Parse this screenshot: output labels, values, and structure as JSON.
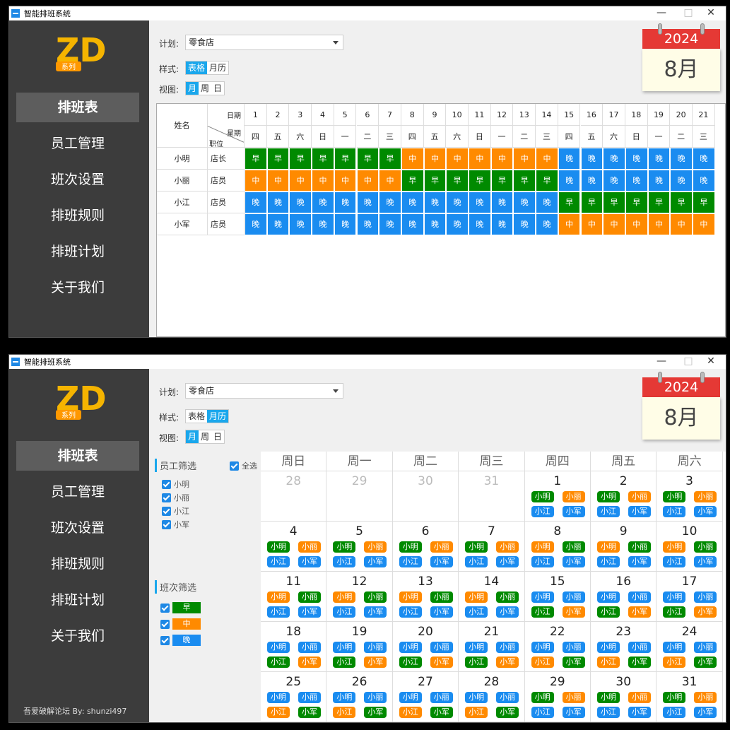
{
  "app_title": "智能排班系统",
  "window_controls": {
    "minimize": "—",
    "maximize": "□",
    "close": "✕"
  },
  "logo": {
    "letters": "ZD",
    "badge": "系列"
  },
  "menu": [
    {
      "label": "排班表",
      "active": true
    },
    {
      "label": "员工管理"
    },
    {
      "label": "班次设置"
    },
    {
      "label": "排班规则"
    },
    {
      "label": "排班计划"
    },
    {
      "label": "关于我们"
    }
  ],
  "credit": "吾爱破解论坛 By: shunzi497",
  "plan": {
    "label": "计划:",
    "value": "零食店"
  },
  "style": {
    "label": "样式:",
    "options": [
      "表格",
      "月历"
    ]
  },
  "view": {
    "label": "视图:",
    "options": [
      "月",
      "周",
      "日"
    ],
    "selected": "月"
  },
  "calendar": {
    "year": "2024",
    "month": "8月"
  },
  "colors": {
    "早": "#008a00",
    "中": "#ff8a00",
    "晚": "#1a8cf0"
  },
  "table": {
    "header_name": "姓名",
    "header_date": "日期",
    "header_week": "星期",
    "header_pos": "职位",
    "dates": [
      "1",
      "2",
      "3",
      "4",
      "5",
      "6",
      "7",
      "8",
      "9",
      "10",
      "11",
      "12",
      "13",
      "14",
      "15",
      "16",
      "17",
      "18",
      "19",
      "20",
      "21"
    ],
    "weekdays": [
      "四",
      "五",
      "六",
      "日",
      "一",
      "二",
      "三",
      "四",
      "五",
      "六",
      "日",
      "一",
      "二",
      "三",
      "四",
      "五",
      "六",
      "日",
      "一",
      "二",
      "三"
    ],
    "rows": [
      {
        "name": "小明",
        "position": "店长",
        "shifts": [
          "早",
          "早",
          "早",
          "早",
          "早",
          "早",
          "早",
          "中",
          "中",
          "中",
          "中",
          "中",
          "中",
          "中",
          "晚",
          "晚",
          "晚",
          "晚",
          "晚",
          "晚",
          "晚"
        ]
      },
      {
        "name": "小丽",
        "position": "店员",
        "shifts": [
          "中",
          "中",
          "中",
          "中",
          "中",
          "中",
          "中",
          "早",
          "早",
          "早",
          "早",
          "早",
          "早",
          "早",
          "晚",
          "晚",
          "晚",
          "晚",
          "晚",
          "晚",
          "晚"
        ]
      },
      {
        "name": "小江",
        "position": "店员",
        "shifts": [
          "晚",
          "晚",
          "晚",
          "晚",
          "晚",
          "晚",
          "晚",
          "晚",
          "晚",
          "晚",
          "晚",
          "晚",
          "晚",
          "晚",
          "早",
          "早",
          "早",
          "早",
          "早",
          "早",
          "早"
        ]
      },
      {
        "name": "小军",
        "position": "店员",
        "shifts": [
          "晚",
          "晚",
          "晚",
          "晚",
          "晚",
          "晚",
          "晚",
          "晚",
          "晚",
          "晚",
          "晚",
          "晚",
          "晚",
          "晚",
          "中",
          "中",
          "中",
          "中",
          "中",
          "中",
          "中"
        ]
      }
    ]
  },
  "filters": {
    "employee_title": "员工筛选",
    "select_all": "全选",
    "employees": [
      "小明",
      "小丽",
      "小江",
      "小军"
    ],
    "shift_title": "班次筛选",
    "shifts": [
      "早",
      "中",
      "晚"
    ]
  },
  "month_view": {
    "weekdays": [
      "周日",
      "周一",
      "周二",
      "周三",
      "周四",
      "周五",
      "周六"
    ],
    "weeks": [
      [
        {
          "d": "28",
          "dim": true
        },
        {
          "d": "29",
          "dim": true
        },
        {
          "d": "30",
          "dim": true
        },
        {
          "d": "31",
          "dim": true
        },
        {
          "d": "1",
          "p": [
            [
              "小明",
              "早"
            ],
            [
              "小丽",
              "中"
            ],
            [
              "小江",
              "晚"
            ],
            [
              "小军",
              "晚"
            ]
          ]
        },
        {
          "d": "2",
          "p": [
            [
              "小明",
              "早"
            ],
            [
              "小丽",
              "中"
            ],
            [
              "小江",
              "晚"
            ],
            [
              "小军",
              "晚"
            ]
          ]
        },
        {
          "d": "3",
          "p": [
            [
              "小明",
              "早"
            ],
            [
              "小丽",
              "中"
            ],
            [
              "小江",
              "晚"
            ],
            [
              "小军",
              "晚"
            ]
          ]
        }
      ],
      [
        {
          "d": "4",
          "p": [
            [
              "小明",
              "早"
            ],
            [
              "小丽",
              "中"
            ],
            [
              "小江",
              "晚"
            ],
            [
              "小军",
              "晚"
            ]
          ]
        },
        {
          "d": "5",
          "p": [
            [
              "小明",
              "早"
            ],
            [
              "小丽",
              "中"
            ],
            [
              "小江",
              "晚"
            ],
            [
              "小军",
              "晚"
            ]
          ]
        },
        {
          "d": "6",
          "p": [
            [
              "小明",
              "早"
            ],
            [
              "小丽",
              "中"
            ],
            [
              "小江",
              "晚"
            ],
            [
              "小军",
              "晚"
            ]
          ]
        },
        {
          "d": "7",
          "p": [
            [
              "小明",
              "早"
            ],
            [
              "小丽",
              "中"
            ],
            [
              "小江",
              "晚"
            ],
            [
              "小军",
              "晚"
            ]
          ]
        },
        {
          "d": "8",
          "p": [
            [
              "小明",
              "中"
            ],
            [
              "小丽",
              "早"
            ],
            [
              "小江",
              "晚"
            ],
            [
              "小军",
              "晚"
            ]
          ]
        },
        {
          "d": "9",
          "p": [
            [
              "小明",
              "中"
            ],
            [
              "小丽",
              "早"
            ],
            [
              "小江",
              "晚"
            ],
            [
              "小军",
              "晚"
            ]
          ]
        },
        {
          "d": "10",
          "p": [
            [
              "小明",
              "中"
            ],
            [
              "小丽",
              "早"
            ],
            [
              "小江",
              "晚"
            ],
            [
              "小军",
              "晚"
            ]
          ]
        }
      ],
      [
        {
          "d": "11",
          "p": [
            [
              "小明",
              "中"
            ],
            [
              "小丽",
              "早"
            ],
            [
              "小江",
              "晚"
            ],
            [
              "小军",
              "晚"
            ]
          ]
        },
        {
          "d": "12",
          "p": [
            [
              "小明",
              "中"
            ],
            [
              "小丽",
              "早"
            ],
            [
              "小江",
              "晚"
            ],
            [
              "小军",
              "晚"
            ]
          ]
        },
        {
          "d": "13",
          "p": [
            [
              "小明",
              "中"
            ],
            [
              "小丽",
              "早"
            ],
            [
              "小江",
              "晚"
            ],
            [
              "小军",
              "晚"
            ]
          ]
        },
        {
          "d": "14",
          "p": [
            [
              "小明",
              "中"
            ],
            [
              "小丽",
              "早"
            ],
            [
              "小江",
              "晚"
            ],
            [
              "小军",
              "晚"
            ]
          ]
        },
        {
          "d": "15",
          "p": [
            [
              "小明",
              "晚"
            ],
            [
              "小丽",
              "晚"
            ],
            [
              "小江",
              "早"
            ],
            [
              "小军",
              "中"
            ]
          ]
        },
        {
          "d": "16",
          "p": [
            [
              "小明",
              "晚"
            ],
            [
              "小丽",
              "晚"
            ],
            [
              "小江",
              "早"
            ],
            [
              "小军",
              "中"
            ]
          ]
        },
        {
          "d": "17",
          "p": [
            [
              "小明",
              "晚"
            ],
            [
              "小丽",
              "晚"
            ],
            [
              "小江",
              "早"
            ],
            [
              "小军",
              "中"
            ]
          ]
        }
      ],
      [
        {
          "d": "18",
          "p": [
            [
              "小明",
              "晚"
            ],
            [
              "小丽",
              "晚"
            ],
            [
              "小江",
              "早"
            ],
            [
              "小军",
              "中"
            ]
          ]
        },
        {
          "d": "19",
          "p": [
            [
              "小明",
              "晚"
            ],
            [
              "小丽",
              "晚"
            ],
            [
              "小江",
              "早"
            ],
            [
              "小军",
              "中"
            ]
          ]
        },
        {
          "d": "20",
          "p": [
            [
              "小明",
              "晚"
            ],
            [
              "小丽",
              "晚"
            ],
            [
              "小江",
              "早"
            ],
            [
              "小军",
              "中"
            ]
          ]
        },
        {
          "d": "21",
          "p": [
            [
              "小明",
              "晚"
            ],
            [
              "小丽",
              "晚"
            ],
            [
              "小江",
              "早"
            ],
            [
              "小军",
              "中"
            ]
          ]
        },
        {
          "d": "22",
          "p": [
            [
              "小明",
              "晚"
            ],
            [
              "小丽",
              "晚"
            ],
            [
              "小江",
              "中"
            ],
            [
              "小军",
              "早"
            ]
          ]
        },
        {
          "d": "23",
          "p": [
            [
              "小明",
              "晚"
            ],
            [
              "小丽",
              "晚"
            ],
            [
              "小江",
              "中"
            ],
            [
              "小军",
              "早"
            ]
          ]
        },
        {
          "d": "24",
          "p": [
            [
              "小明",
              "晚"
            ],
            [
              "小丽",
              "晚"
            ],
            [
              "小江",
              "中"
            ],
            [
              "小军",
              "早"
            ]
          ]
        }
      ],
      [
        {
          "d": "25",
          "p": [
            [
              "小明",
              "晚"
            ],
            [
              "小丽",
              "晚"
            ],
            [
              "小江",
              "中"
            ],
            [
              "小军",
              "早"
            ]
          ]
        },
        {
          "d": "26",
          "p": [
            [
              "小明",
              "晚"
            ],
            [
              "小丽",
              "晚"
            ],
            [
              "小江",
              "中"
            ],
            [
              "小军",
              "早"
            ]
          ]
        },
        {
          "d": "27",
          "p": [
            [
              "小明",
              "晚"
            ],
            [
              "小丽",
              "晚"
            ],
            [
              "小江",
              "中"
            ],
            [
              "小军",
              "早"
            ]
          ]
        },
        {
          "d": "28",
          "p": [
            [
              "小明",
              "晚"
            ],
            [
              "小丽",
              "晚"
            ],
            [
              "小江",
              "中"
            ],
            [
              "小军",
              "早"
            ]
          ]
        },
        {
          "d": "29",
          "p": [
            [
              "小明",
              "早"
            ],
            [
              "小丽",
              "中"
            ],
            [
              "小江",
              "晚"
            ],
            [
              "小军",
              "晚"
            ]
          ]
        },
        {
          "d": "30",
          "p": [
            [
              "小明",
              "早"
            ],
            [
              "小丽",
              "中"
            ],
            [
              "小江",
              "晚"
            ],
            [
              "小军",
              "晚"
            ]
          ]
        },
        {
          "d": "31",
          "p": [
            [
              "小明",
              "早"
            ],
            [
              "小丽",
              "中"
            ],
            [
              "小江",
              "晚"
            ],
            [
              "小军",
              "晚"
            ]
          ]
        }
      ]
    ]
  }
}
